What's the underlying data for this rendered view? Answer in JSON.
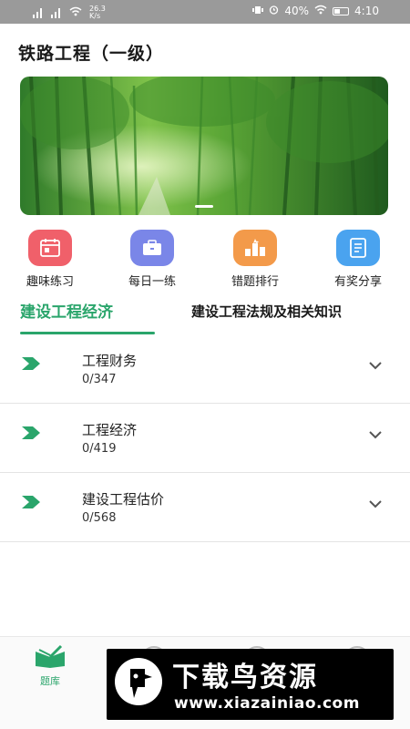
{
  "status_bar": {
    "left_speed": "26.3\nK/s",
    "battery": "40%",
    "time": "4:10"
  },
  "page": {
    "title": "铁路工程（一级）"
  },
  "quick_actions": [
    {
      "label": "趣味练习",
      "icon": "calendar-icon",
      "color": "#f0606a"
    },
    {
      "label": "每日一练",
      "icon": "briefcase-icon",
      "color": "#7a86e8"
    },
    {
      "label": "错题排行",
      "icon": "ranking-icon",
      "color": "#f39a4a"
    },
    {
      "label": "有奖分享",
      "icon": "book-icon",
      "color": "#4aa3ef"
    }
  ],
  "tabs": [
    {
      "label": "建设工程经济",
      "active": true
    },
    {
      "label": "建设工程法规及相关知识",
      "active": false
    }
  ],
  "subjects": [
    {
      "name": "工程财务",
      "count": "0/347"
    },
    {
      "name": "工程经济",
      "count": "0/419"
    },
    {
      "name": "建设工程估价",
      "count": "0/568"
    }
  ],
  "bottom_nav": {
    "active_label": "题库"
  },
  "watermark": {
    "title": "下载鸟资源",
    "url": "www.xiazainiao.com"
  },
  "colors": {
    "accent": "#2aa56b",
    "status_bar": "#9a9a9a"
  }
}
